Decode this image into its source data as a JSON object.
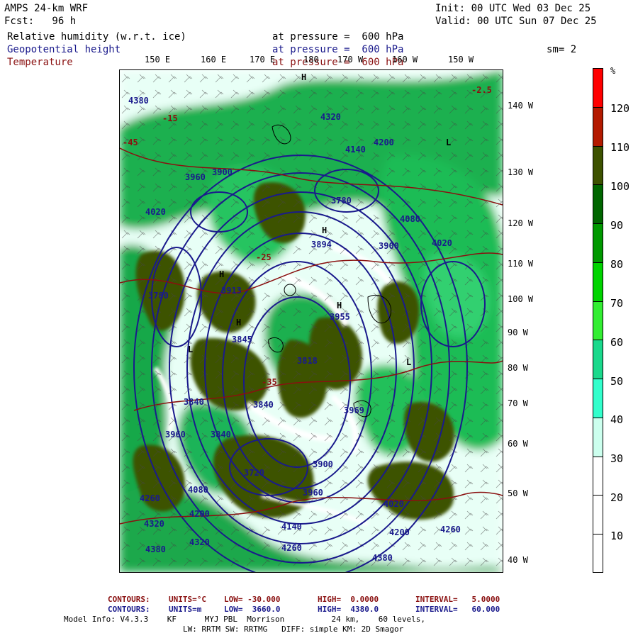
{
  "header": {
    "model_title": "AMPS 24-km WRF",
    "init": "Init: 00 UTC Wed 03 Dec 25",
    "fcst": "Fcst:   96 h",
    "valid": "Valid: 00 UTC Sun 07 Dec 25",
    "smoothing": "sm= 2"
  },
  "fields": [
    {
      "name": "Relative humidity (w.r.t. ice)",
      "level": "at pressure =  600 hPa",
      "color": "#000000"
    },
    {
      "name": "Geopotential height",
      "level": "at pressure =  600 hPa",
      "color": "#1a1a8c"
    },
    {
      "name": "Temperature",
      "level": "at pressure =  600 hPa",
      "color": "#8a1010"
    }
  ],
  "longitude_labels": [
    "150 E",
    "160 E",
    "170 E",
    "180",
    "170 W",
    "160 W",
    "150 W"
  ],
  "latitude_labels": [
    "140 W",
    "130 W",
    "120 W",
    "110 W",
    "100 W",
    "90 W",
    "80 W",
    "70 W",
    "60 W",
    "50 W",
    "40 W"
  ],
  "colorbar": {
    "unit": "%",
    "labels": [
      "120",
      "110",
      "100",
      "90",
      "80",
      "70",
      "60",
      "50",
      "40",
      "30",
      "20",
      "10"
    ],
    "colors": [
      "#ff0000",
      "#b31a00",
      "#3d5200",
      "#006600",
      "#009900",
      "#00d400",
      "#33ee33",
      "#1ad98c",
      "#33ffcc",
      "#ccffee",
      "#ffffff",
      "#ffffff",
      "#ffffff"
    ]
  },
  "height_labels": [
    "4380",
    "4320",
    "4200",
    "4140",
    "4080",
    "4020",
    "4020",
    "3960",
    "3900",
    "3900",
    "3840",
    "3840",
    "3840",
    "3780",
    "3780",
    "3720",
    "3894",
    "3913",
    "3845",
    "3955",
    "3818",
    "3969",
    "4260",
    "4320",
    "4380",
    "4200",
    "4080",
    "4140",
    "4260",
    "4320",
    "4200",
    "4020",
    "3960",
    "3900",
    "3960",
    "4260",
    "4380"
  ],
  "temperature_labels": [
    "-25",
    "-15",
    "-35",
    "-45",
    "-2.5"
  ],
  "center_labels": [
    "H",
    "H",
    "H",
    "H",
    "L",
    "L",
    "H",
    "L"
  ],
  "footer": {
    "temp_contours": {
      "label": "CONTOURS:",
      "units": "UNITS=°C",
      "low": "LOW= -30.000",
      "high": "HIGH=  0.0000",
      "interval": "INTERVAL=   5.0000"
    },
    "height_contours": {
      "label": "CONTOURS:",
      "units": "UNITS=m",
      "low": "LOW=  3660.0",
      "high": "HIGH=  4380.0",
      "interval": "INTERVAL=   60.000"
    },
    "model_info": "Model Info: V4.3.3    KF      MYJ PBL  Morrison          24 km,    60 levels,",
    "physics": "LW: RRTM SW: RRTMG   DIFF: simple KM: 2D Smagor"
  }
}
